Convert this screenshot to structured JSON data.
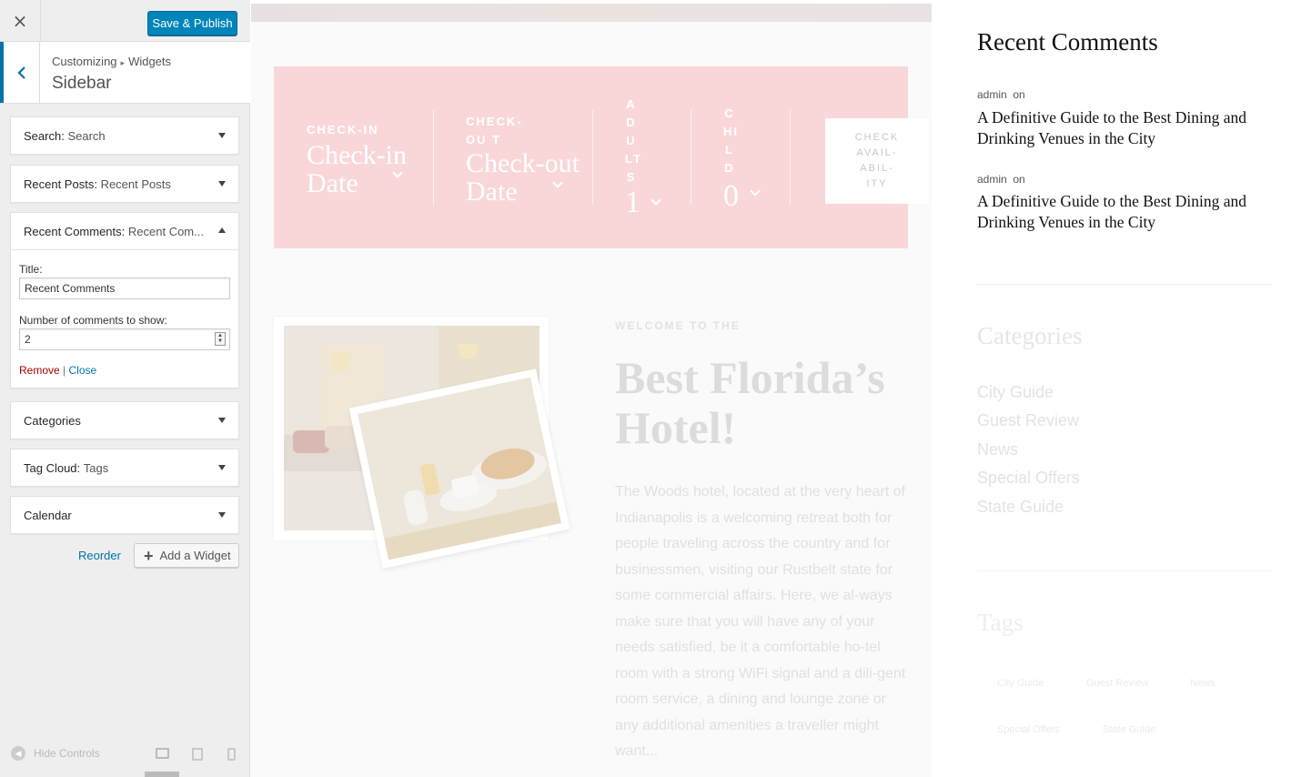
{
  "customizer": {
    "save_label": "Save & Publish",
    "close_glyph": "×",
    "breadcrumb": {
      "root": "Customizing",
      "separator": "▸",
      "current": "Widgets"
    },
    "section_title": "Sidebar",
    "widgets": [
      {
        "name": "Search",
        "title": "Search",
        "expanded": false
      },
      {
        "name": "Recent Posts",
        "title": "Recent Posts",
        "expanded": false
      },
      {
        "name": "Recent Comments",
        "title": "Recent Com...",
        "expanded": true
      },
      {
        "name": "Categories",
        "title": "",
        "expanded": false
      },
      {
        "name": "Tag Cloud",
        "title": "Tags",
        "expanded": false
      },
      {
        "name": "Calendar",
        "title": "",
        "expanded": false
      }
    ],
    "recent_comments_form": {
      "title_label": "Title:",
      "title_value": "Recent Comments",
      "count_label": "Number of comments to show:",
      "count_value": "2",
      "remove_label": "Remove",
      "divider": "|",
      "close_label": "Close"
    },
    "reorder_label": "Reorder",
    "add_widget_label": "Add a Widget",
    "hide_controls_label": "Hide Controls"
  },
  "preview": {
    "booking": {
      "checkin_label": "CHECK-IN",
      "checkin_value": "Check-in Date",
      "checkout_label": "CHECK-OU T",
      "checkout_value": "Check-out Date",
      "adults_label": [
        "A",
        "D",
        "U",
        "LT",
        "S"
      ],
      "adults_value": "1",
      "child_label": [
        "C",
        "HI",
        "L",
        "D"
      ],
      "child_value": "0",
      "button_label": [
        "CHECK",
        "AVAIL-",
        "ABIL-",
        "ITY"
      ]
    },
    "welcome": {
      "kicker": "WELCOME TO THE",
      "title": "Best Florida’s Hotel!",
      "body": "The Woods hotel, located at the very heart of Indianapolis is a welcoming retreat both for people traveling across the country and for businessmen, visiting our Rustbelt state for some commercial affairs. Here, we al-ways make sure that you will have any of your needs satisfied, be it a comfortable ho-tel room with a strong WiFi signal and a dili-gent room service, a dining and lounge zone or any additional amenities a traveller might want..."
    },
    "sidebar": {
      "recent_comments_title": "Recent Comments",
      "comments": [
        {
          "author": "admin",
          "on": "on",
          "post": "A Definitive Guide to the Best Dining and Drinking Venues in the City"
        },
        {
          "author": "admin",
          "on": "on",
          "post": "A Definitive Guide to the Best Dining and Drinking Venues in the City"
        }
      ],
      "categories_title": "Categories",
      "categories": [
        "City Guide",
        "Guest Review",
        "News",
        "Special Offers",
        "State Guide"
      ],
      "tags_title": "Tags",
      "tags": [
        "City Guide",
        "Guest Review",
        "News",
        "Special Offers",
        "State Guide"
      ]
    }
  },
  "colors": {
    "accent": "#0085ba",
    "link": "#0073aa",
    "remove": "#aa0000",
    "booking_bg": "#f9d7d9"
  }
}
